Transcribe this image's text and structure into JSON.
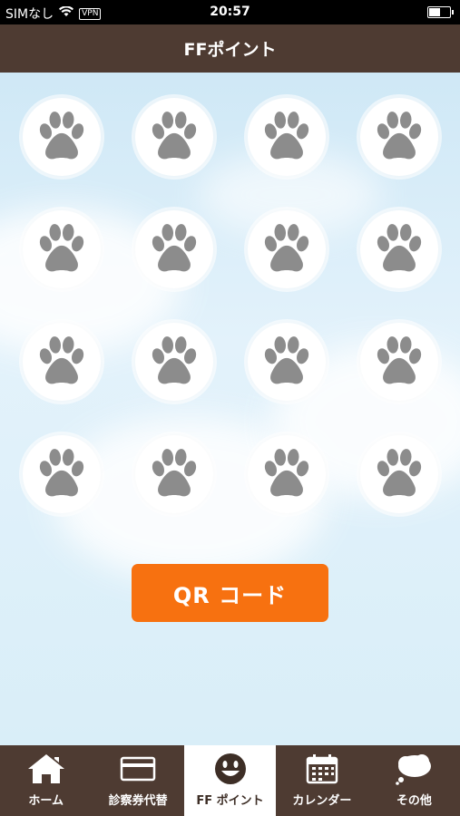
{
  "status_bar": {
    "carrier": "SIMなし",
    "vpn": "VPN",
    "time": "20:57"
  },
  "header": {
    "title": "FFポイント"
  },
  "stamps": {
    "count": 16,
    "icon": "paw-icon",
    "fill_color": "#8c8c8c"
  },
  "qr_button": {
    "label": "QR コード",
    "color": "#f77110"
  },
  "tabs": [
    {
      "label": "ホーム",
      "icon": "home-icon",
      "active": false
    },
    {
      "label": "診察券代替",
      "icon": "card-icon",
      "active": false
    },
    {
      "label": "FF ポイント",
      "icon": "smiley-icon",
      "active": true
    },
    {
      "label": "カレンダー",
      "icon": "calendar-icon",
      "active": false
    },
    {
      "label": "その他",
      "icon": "more-bubble-icon",
      "active": false
    }
  ]
}
